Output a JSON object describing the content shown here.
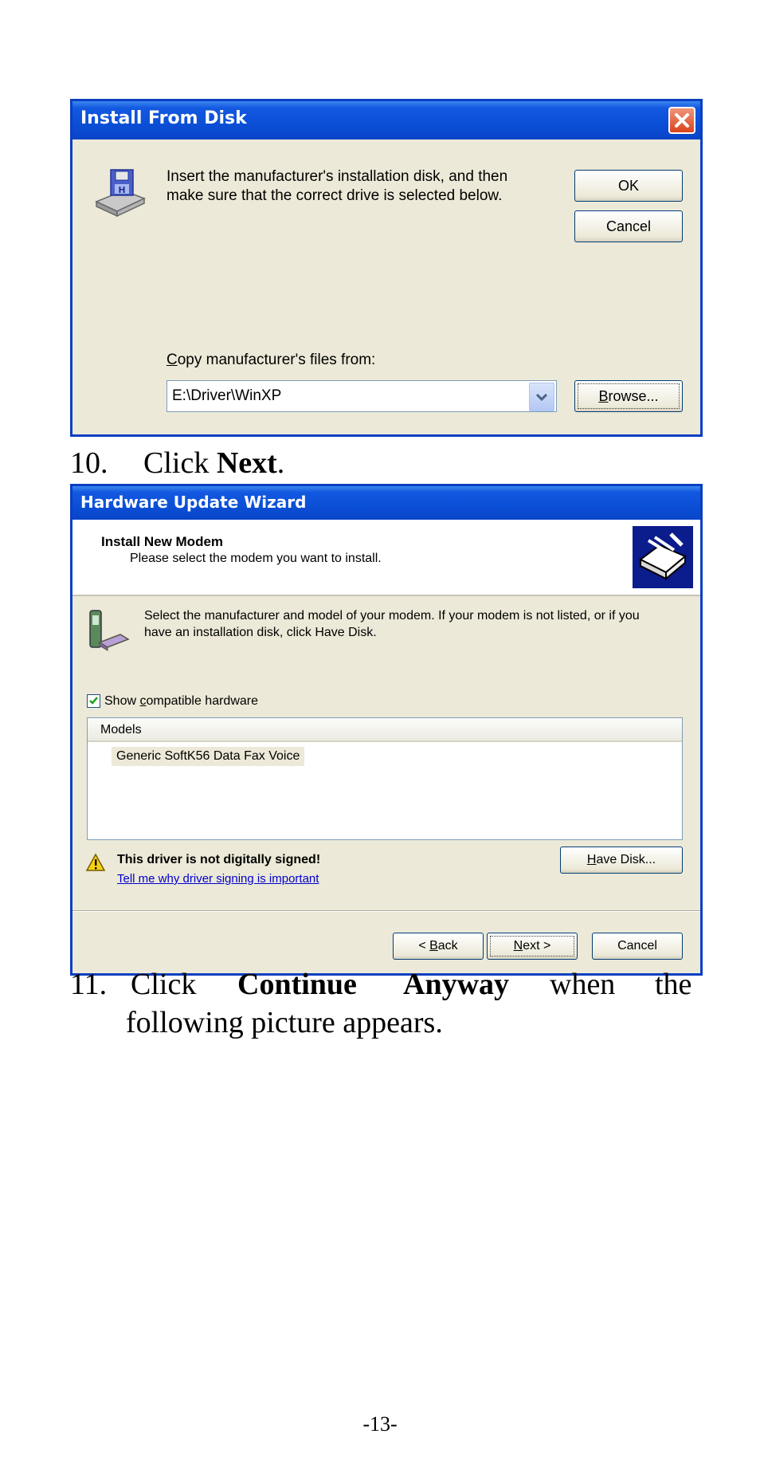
{
  "dialog1": {
    "title": "Install From Disk",
    "message_line1": "Insert the manufacturer's installation disk, and then",
    "message_line2": "make sure that the correct drive is selected below.",
    "ok_label": "OK",
    "cancel_label": "Cancel",
    "copy_label_first": "C",
    "copy_label_rest": "opy manufacturer's files from:",
    "path_value": "E:\\Driver\\WinXP",
    "browse_first": "B",
    "browse_rest": "rowse..."
  },
  "step10": {
    "number": "10.",
    "prefix": "Click ",
    "bold": "Next",
    "suffix": "."
  },
  "dialog2": {
    "title": "Hardware Update Wizard",
    "header_title": "Install New Modem",
    "header_subtitle": "Please select the modem you want to install.",
    "instruction_line1": "Select the manufacturer and model of your modem. If your modem is not listed, or if you",
    "instruction_line2": "have an installation disk, click Have Disk.",
    "checkbox_pre": "Show ",
    "checkbox_ul": "c",
    "checkbox_post": "ompatible hardware",
    "models_header": "Models",
    "models": [
      "Generic SoftK56 Data Fax Voice"
    ],
    "warning_text": "This driver is not digitally signed!",
    "warning_link": "Tell me why driver signing is important",
    "have_disk_ul": "H",
    "have_disk_rest": "ave Disk...",
    "back_pre": "< ",
    "back_ul": "B",
    "back_rest": "ack",
    "next_ul": "N",
    "next_rest": "ext >",
    "cancel_label": "Cancel"
  },
  "step11": {
    "number": "11.",
    "word_click": "Click",
    "bold1": "Continue",
    "bold2": "Anyway",
    "word_when": "when",
    "word_the": "the",
    "line2": "following picture appears."
  },
  "page_number": "-13-",
  "colors": {
    "title_blue": "#0a4fd6",
    "dialog_face": "#ece9d8",
    "close_red": "#e0502a",
    "link_blue": "#0000cc",
    "check_green": "#21a121"
  }
}
